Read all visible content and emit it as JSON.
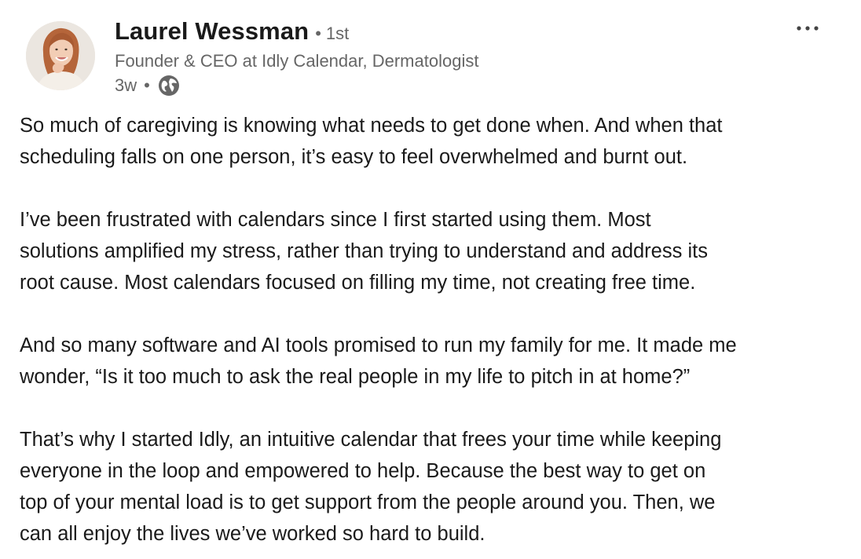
{
  "author": {
    "name": "Laurel Wessman",
    "degree": "1st",
    "headline": "Founder & CEO at Idly Calendar, Dermatologist",
    "posted_ago": "3w",
    "visibility_icon": "globe-icon"
  },
  "menu": {
    "more_icon": "more-horizontal-icon"
  },
  "post": {
    "paragraphs": [
      {
        "lines": [
          "So much of caregiving is knowing what needs to get done when. And when that",
          "scheduling falls on one person, it’s easy to feel overwhelmed and burnt out."
        ]
      },
      {
        "lines": [
          "I’ve been frustrated with calendars since I first started using them. Most",
          "solutions amplified my stress, rather than trying to understand and address its",
          "root cause. Most calendars focused on filling my time, not creating free time."
        ]
      },
      {
        "lines": [
          "And so many software and AI tools promised to run my family for me. It made me",
          "wonder, “Is it too much to ask the real people in my life to pitch in at home?”"
        ]
      },
      {
        "lines": [
          "That’s why I started Idly, an intuitive calendar that frees your time while keeping",
          "everyone in the loop and empowered to help. Because the best way to get on",
          "top of your mental load is to get support from the people around you. Then, we",
          "can all enjoy the lives we’ve worked so hard to build."
        ]
      }
    ]
  },
  "colors": {
    "primary_text": "#1a1a1a",
    "secondary_text": "#666666",
    "background": "#ffffff"
  }
}
